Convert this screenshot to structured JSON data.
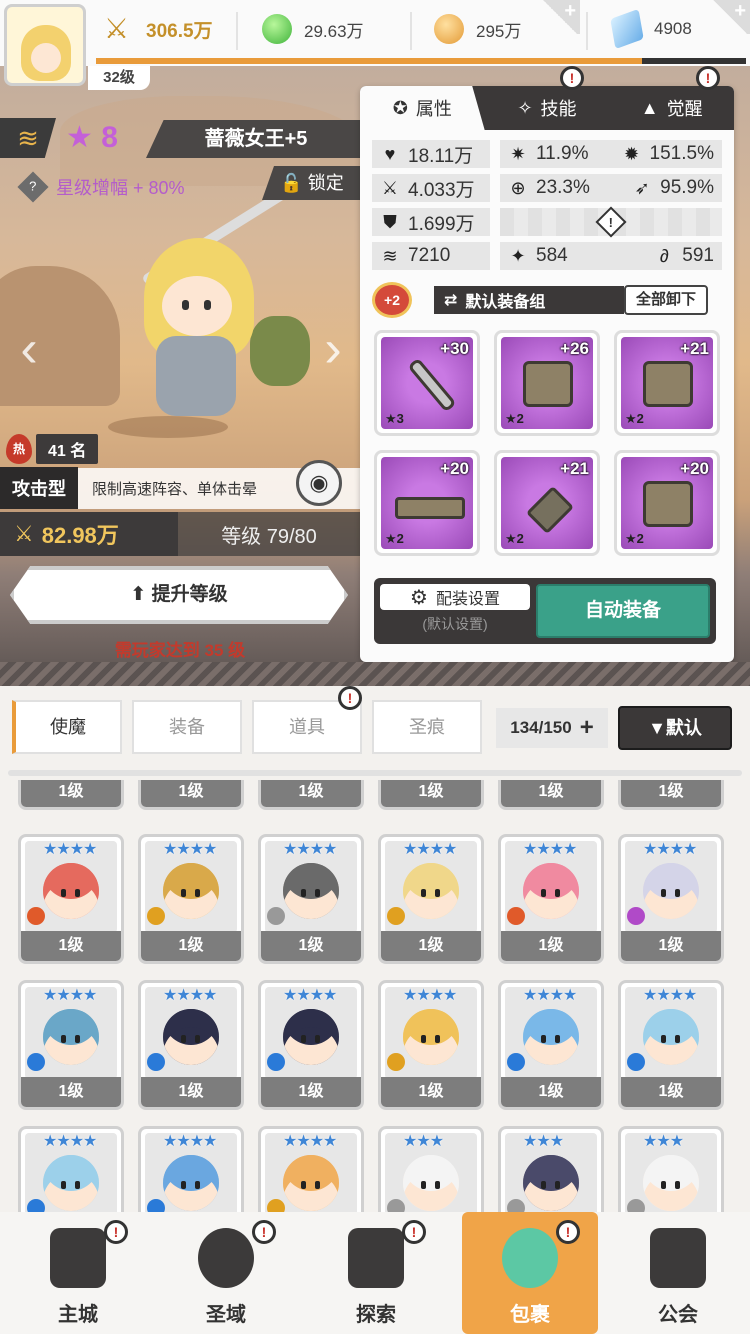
{
  "top_bar": {
    "level": "32级",
    "power": "306.5万",
    "green_currency": "29.63万",
    "gold_currency": "295万",
    "gem_currency": "4908",
    "xp_fraction": 0.84
  },
  "hero": {
    "star_count": "8",
    "name": "蔷薇女王+5",
    "star_bonus": "星级增幅 + 80%",
    "lock_label": "锁定",
    "hot_icon": "热",
    "rank": "41 名",
    "type": "攻击型",
    "type_desc": "限制高速阵容、单体击晕",
    "power": "82.98万",
    "level_text": "等级 79/80",
    "level_up_label": "提升等级",
    "requirement": "需玩家达到 35 级"
  },
  "panel": {
    "tabs": [
      {
        "label": "属性",
        "icon": "stats-icon"
      },
      {
        "label": "技能",
        "icon": "skill-icon"
      },
      {
        "label": "觉醒",
        "icon": "awaken-icon"
      }
    ],
    "stats": {
      "hp": "18.11万",
      "attack": "4.033万",
      "defense": "1.699万",
      "speed": "7210",
      "crit_rate": "11.9%",
      "crit_damage": "151.5%",
      "accuracy": "23.3%",
      "dodge": "95.9%",
      "effect_hit": "584",
      "effect_resist": "591"
    },
    "equip_bonus": "+2",
    "equip_group": "默认装备组",
    "unequip_all": "全部卸下",
    "equipment": [
      {
        "level": "+30",
        "stars": "★3",
        "type": "sword"
      },
      {
        "level": "+26",
        "stars": "★2",
        "type": "helmet"
      },
      {
        "level": "+21",
        "stars": "★2",
        "type": "armor"
      },
      {
        "level": "+20",
        "stars": "★2",
        "type": "belt"
      },
      {
        "level": "+21",
        "stars": "★2",
        "type": "amulet"
      },
      {
        "level": "+20",
        "stars": "★2",
        "type": "boots"
      }
    ],
    "config_label": "配装设置",
    "config_sub": "(默认设置)",
    "auto_equip": "自动装备"
  },
  "bag": {
    "tabs": [
      "使魔",
      "装备",
      "道具",
      "圣痕"
    ],
    "count": "134/150",
    "sort_label": "▼默认",
    "top_row_levels": [
      "1级",
      "1级",
      "1级",
      "1级",
      "1级",
      "1级"
    ],
    "cards": [
      {
        "level": "1级",
        "stars": "★★★★",
        "hair": "#e56a5e",
        "cls": "#e05a2a"
      },
      {
        "level": "1级",
        "stars": "★★★★",
        "hair": "#d9a94a",
        "cls": "#e0a020"
      },
      {
        "level": "1级",
        "stars": "★★★★",
        "hair": "#6a6a6a",
        "cls": "#999999"
      },
      {
        "level": "1级",
        "stars": "★★★★",
        "hair": "#f0d78a",
        "cls": "#e0a020"
      },
      {
        "level": "1级",
        "stars": "★★★★",
        "hair": "#f08aa0",
        "cls": "#e05a2a"
      },
      {
        "level": "1级",
        "stars": "★★★★",
        "hair": "#d4d4e8",
        "cls": "#b04ac8"
      },
      {
        "level": "1级",
        "stars": "★★★★",
        "hair": "#6aa7c8",
        "cls": "#2a7ad8"
      },
      {
        "level": "1级",
        "stars": "★★★★",
        "hair": "#2d2f4a",
        "cls": "#2a7ad8"
      },
      {
        "level": "1级",
        "stars": "★★★★",
        "hair": "#2d2f4a",
        "cls": "#2a7ad8"
      },
      {
        "level": "1级",
        "stars": "★★★★",
        "hair": "#f0c25a",
        "cls": "#e0a020"
      },
      {
        "level": "1级",
        "stars": "★★★★",
        "hair": "#7ab8e8",
        "cls": "#2a7ad8"
      },
      {
        "level": "1级",
        "stars": "★★★★",
        "hair": "#9cd0ea",
        "cls": "#2a7ad8"
      },
      {
        "level": "",
        "stars": "★★★★",
        "hair": "#9cd0ea",
        "cls": "#2a7ad8"
      },
      {
        "level": "",
        "stars": "★★★★",
        "hair": "#6aa7e0",
        "cls": "#2a7ad8"
      },
      {
        "level": "",
        "stars": "★★★★",
        "hair": "#f0b060",
        "cls": "#e0a020"
      },
      {
        "level": "",
        "stars": "★★★",
        "hair": "#f4f4f4",
        "cls": "#999999"
      },
      {
        "level": "",
        "stars": "★★★",
        "hair": "#4a4a6a",
        "cls": "#999999"
      },
      {
        "level": "",
        "stars": "★★★",
        "hair": "#f4f4f4",
        "cls": "#999999"
      }
    ]
  },
  "bottom_nav": [
    {
      "label": "主城",
      "icon": "castle-icon"
    },
    {
      "label": "圣域",
      "icon": "portal-icon"
    },
    {
      "label": "探索",
      "icon": "sword-stone-icon"
    },
    {
      "label": "包裹",
      "icon": "bag-icon"
    },
    {
      "label": "公会",
      "icon": "guild-icon"
    }
  ],
  "colors": {
    "accent_orange": "#e99b3a",
    "star_purple": "#c460d8",
    "auto_equip_green": "#3aa189",
    "requirement_red": "#c33a2c"
  }
}
